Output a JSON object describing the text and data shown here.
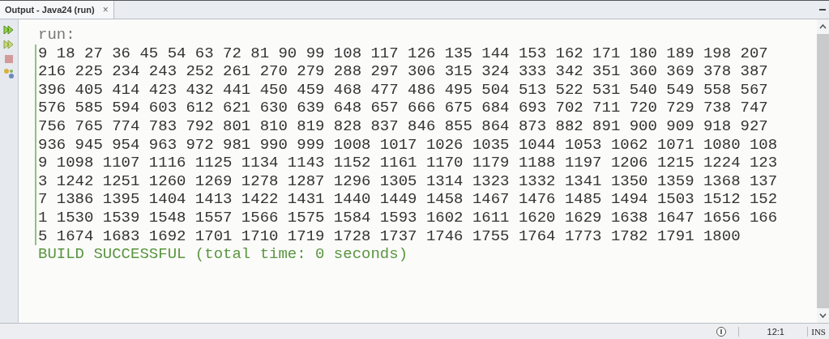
{
  "tab": {
    "title": "Output - Java24 (run)",
    "close": "×"
  },
  "output": {
    "lines": [
      {
        "kind": "plain",
        "text": "run:"
      },
      {
        "kind": "stdout",
        "text": "9 18 27 36 45 54 63 72 81 90 99 108 117 126 135 144 153 162 171 180 189 198 207"
      },
      {
        "kind": "stdout",
        "text": "216 225 234 243 252 261 270 279 288 297 306 315 324 333 342 351 360 369 378 387"
      },
      {
        "kind": "stdout",
        "text": "396 405 414 423 432 441 450 459 468 477 486 495 504 513 522 531 540 549 558 567"
      },
      {
        "kind": "stdout",
        "text": "576 585 594 603 612 621 630 639 648 657 666 675 684 693 702 711 720 729 738 747"
      },
      {
        "kind": "stdout",
        "text": "756 765 774 783 792 801 810 819 828 837 846 855 864 873 882 891 900 909 918 927"
      },
      {
        "kind": "stdout",
        "text": "936 945 954 963 972 981 990 999 1008 1017 1026 1035 1044 1053 1062 1071 1080 108"
      },
      {
        "kind": "stdout",
        "text": "9 1098 1107 1116 1125 1134 1143 1152 1161 1170 1179 1188 1197 1206 1215 1224 123"
      },
      {
        "kind": "stdout",
        "text": "3 1242 1251 1260 1269 1278 1287 1296 1305 1314 1323 1332 1341 1350 1359 1368 137"
      },
      {
        "kind": "stdout",
        "text": "7 1386 1395 1404 1413 1422 1431 1440 1449 1458 1467 1476 1485 1494 1503 1512 152"
      },
      {
        "kind": "stdout",
        "text": "1 1530 1539 1548 1557 1566 1575 1584 1593 1602 1611 1620 1629 1638 1647 1656 166"
      },
      {
        "kind": "stdout",
        "text": "5 1674 1683 1692 1701 1710 1719 1728 1737 1746 1755 1764 1773 1782 1791 1800"
      },
      {
        "kind": "success",
        "text": "BUILD SUCCESSFUL (total time: 0 seconds)"
      }
    ]
  },
  "status_bar": {
    "position": "12:1",
    "mode": "INS"
  }
}
